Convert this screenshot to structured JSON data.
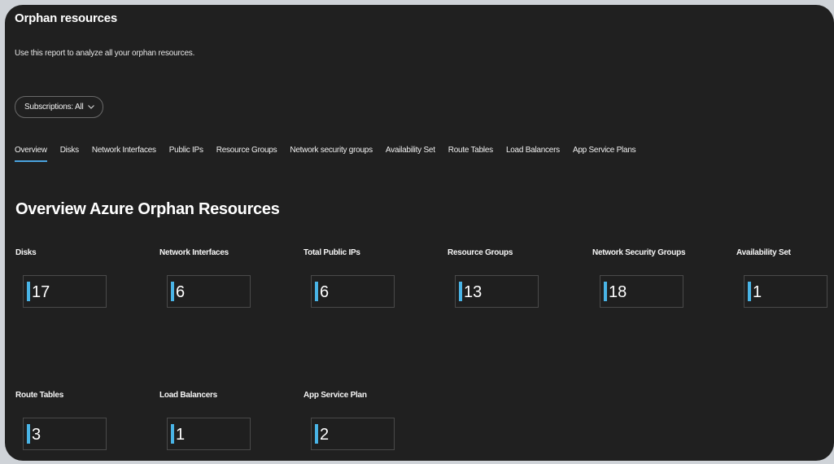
{
  "header": {
    "title": "Orphan resources",
    "subtitle": "Use this report to analyze all your orphan resources."
  },
  "filter": {
    "label": "Subscriptions: All"
  },
  "tabs": [
    {
      "label": "Overview",
      "active": true
    },
    {
      "label": "Disks"
    },
    {
      "label": "Network Interfaces"
    },
    {
      "label": "Public IPs"
    },
    {
      "label": "Resource Groups"
    },
    {
      "label": "Network security groups"
    },
    {
      "label": "Availability Set"
    },
    {
      "label": "Route Tables"
    },
    {
      "label": "Load Balancers"
    },
    {
      "label": "App Service Plans"
    }
  ],
  "section": {
    "title": "Overview Azure Orphan Resources"
  },
  "kpis": [
    {
      "label": "Disks",
      "value": "17"
    },
    {
      "label": "Network Interfaces",
      "value": "6"
    },
    {
      "label": "Total Public IPs",
      "value": "6"
    },
    {
      "label": "Resource Groups",
      "value": "13"
    },
    {
      "label": "Network Security Groups",
      "value": "18"
    },
    {
      "label": "Availability Set",
      "value": "1"
    },
    {
      "label": "Route Tables",
      "value": "3"
    },
    {
      "label": "Load Balancers",
      "value": "1"
    },
    {
      "label": "App Service Plan",
      "value": "2"
    }
  ],
  "colors": {
    "background": "#202020",
    "accent": "#49b4e6",
    "tab_underline": "#4aa3df"
  }
}
